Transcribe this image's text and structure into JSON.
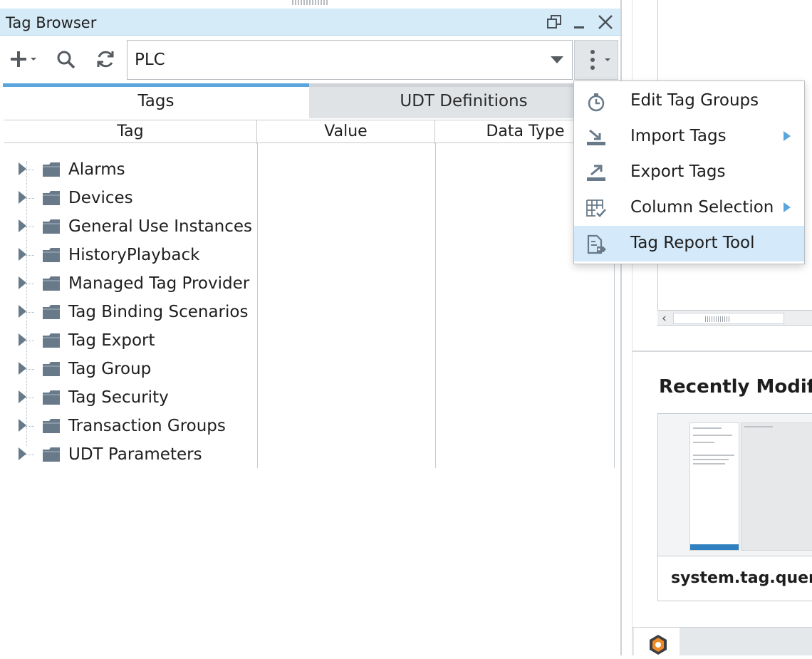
{
  "panel": {
    "title": "Tag Browser",
    "provider": {
      "value": "PLC"
    }
  },
  "tabs": [
    {
      "label": "Tags",
      "active": true
    },
    {
      "label": "UDT Definitions",
      "active": false
    }
  ],
  "table": {
    "columns": [
      "Tag",
      "Value",
      "Data Type"
    ],
    "rows": [
      {
        "name": "Alarms"
      },
      {
        "name": "Devices"
      },
      {
        "name": "General Use Instances"
      },
      {
        "name": "HistoryPlayback"
      },
      {
        "name": "Managed Tag Provider"
      },
      {
        "name": "Tag Binding Scenarios"
      },
      {
        "name": "Tag Export"
      },
      {
        "name": "Tag Group"
      },
      {
        "name": "Tag Security"
      },
      {
        "name": "Transaction Groups"
      },
      {
        "name": "UDT Parameters"
      }
    ]
  },
  "menu": {
    "items": [
      {
        "label": "Edit Tag Groups",
        "icon": "stopwatch-icon",
        "submenu": false
      },
      {
        "label": "Import Tags",
        "icon": "import-icon",
        "submenu": true
      },
      {
        "label": "Export Tags",
        "icon": "export-icon",
        "submenu": false
      },
      {
        "label": "Column Selection",
        "icon": "table-check-icon",
        "submenu": true
      },
      {
        "label": "Tag Report Tool",
        "icon": "report-icon",
        "submenu": false,
        "highlighted": true
      }
    ]
  },
  "right": {
    "recent_title": "Recently Modif",
    "card_label": "system.tag.quer"
  },
  "colors": {
    "accent": "#5aa6dc",
    "title_bar": "#d6ebf8",
    "highlight": "#d4e9f9",
    "icon": "#687a8a"
  }
}
